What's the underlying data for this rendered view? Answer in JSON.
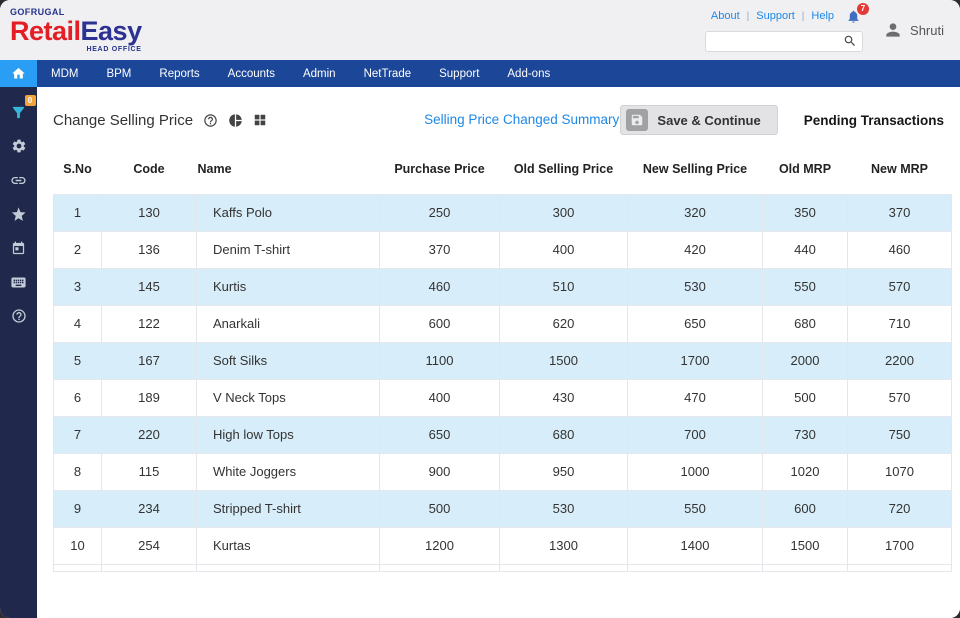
{
  "colors": {
    "nav_blue": "#1c4698",
    "home_tile_blue": "#2a9df4",
    "sidebar_navy": "#20294b",
    "row_alt_blue": "#d7edf9",
    "link_blue": "#1e88e5",
    "badge_red": "#e53935",
    "badge_orange": "#f2a33c",
    "funnel_cyan": "#35b6d9",
    "logo_red": "#e31e24",
    "logo_blue": "#2d3192"
  },
  "header": {
    "brand_top": "GOFRUGAL",
    "logo_part1": "Retail",
    "logo_part2": "Easy",
    "logo_sub": "HEAD OFFICE",
    "links": [
      "About",
      "Support",
      "Help"
    ],
    "notification_count": "7",
    "search_value": "",
    "user_name": "Shruti"
  },
  "nav": {
    "items": [
      "MDM",
      "BPM",
      "Reports",
      "Accounts",
      "Admin",
      "NetTrade",
      "Support",
      "Add-ons"
    ]
  },
  "sidebar": {
    "filter_badge": "0",
    "items": [
      "filter-icon",
      "gear-icon",
      "link-icon",
      "star-icon",
      "calendar-icon",
      "keyboard-icon",
      "help-icon"
    ]
  },
  "toolbar": {
    "title": "Change Selling Price",
    "summary_link": "Selling Price Changed Summary",
    "save_button": "Save & Continue",
    "pending_label": "Pending Transactions"
  },
  "table": {
    "columns": [
      "S.No",
      "Code",
      "Name",
      "Purchase Price",
      "Old Selling Price",
      "New Selling Price",
      "Old MRP",
      "New MRP"
    ],
    "rows": [
      [
        "1",
        "130",
        "Kaffs Polo",
        "250",
        "300",
        "320",
        "350",
        "370"
      ],
      [
        "2",
        "136",
        "Denim T-shirt",
        "370",
        "400",
        "420",
        "440",
        "460"
      ],
      [
        "3",
        "145",
        "Kurtis",
        "460",
        "510",
        "530",
        "550",
        "570"
      ],
      [
        "4",
        "122",
        "Anarkali",
        "600",
        "620",
        "650",
        "680",
        "710"
      ],
      [
        "5",
        "167",
        "Soft Silks",
        "1100",
        "1500",
        "1700",
        "2000",
        "2200"
      ],
      [
        "6",
        "189",
        "V Neck Tops",
        "400",
        "430",
        "470",
        "500",
        "570"
      ],
      [
        "7",
        "220",
        "High low Tops",
        "650",
        "680",
        "700",
        "730",
        "750"
      ],
      [
        "8",
        "115",
        "White Joggers",
        "900",
        "950",
        "1000",
        "1020",
        "1070"
      ],
      [
        "9",
        "234",
        "Stripped T-shirt",
        "500",
        "530",
        "550",
        "600",
        "720"
      ],
      [
        "10",
        "254",
        "Kurtas",
        "1200",
        "1300",
        "1400",
        "1500",
        "1700"
      ]
    ]
  }
}
